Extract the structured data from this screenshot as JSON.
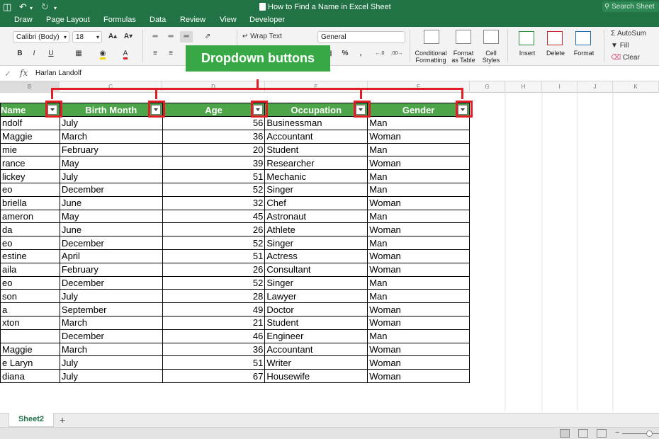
{
  "window": {
    "title": "How to Find a Name in Excel Sheet",
    "search_placeholder": "Search Sheet"
  },
  "ribbon_tabs": [
    "Draw",
    "Page Layout",
    "Formulas",
    "Data",
    "Review",
    "View",
    "Developer"
  ],
  "ribbon": {
    "font_name": "Calibri (Body)",
    "font_size": "18",
    "wrap_text": "Wrap Text",
    "number_format": "General",
    "conditional_formatting": "Conditional Formatting",
    "format_as_table": "Format as Table",
    "cell_styles": "Cell Styles",
    "insert": "Insert",
    "delete": "Delete",
    "format": "Format",
    "autosum": "AutoSum",
    "fill": "Fill",
    "clear": "Clear",
    "bold": "B",
    "italic": "I",
    "underline": "U",
    "percent": "%",
    "comma": ","
  },
  "formula_bar": {
    "fx": "fx",
    "value": "Harlan Landolf"
  },
  "column_letters": [
    "B",
    "C",
    "D",
    "E",
    "F",
    "G",
    "H",
    "I",
    "J",
    "K"
  ],
  "annotation": {
    "label": "Dropdown buttons"
  },
  "table": {
    "headers": [
      "Name",
      "Birth Month",
      "Age",
      "Occupation",
      "Gender"
    ],
    "rows": [
      [
        "ndolf",
        "July",
        "56",
        "Businessman",
        "Man"
      ],
      [
        "Maggie",
        "March",
        "36",
        "Accountant",
        "Woman"
      ],
      [
        "mie",
        "February",
        "20",
        "Student",
        "Man"
      ],
      [
        "rance",
        "May",
        "39",
        "Researcher",
        "Woman"
      ],
      [
        "lickey",
        "July",
        "51",
        "Mechanic",
        "Man"
      ],
      [
        "eo",
        "December",
        "52",
        "Singer",
        "Man"
      ],
      [
        "briella",
        "June",
        "32",
        "Chef",
        "Woman"
      ],
      [
        "ameron",
        "May",
        "45",
        "Astronaut",
        "Man"
      ],
      [
        "da",
        "June",
        "26",
        "Athlete",
        "Woman"
      ],
      [
        "eo",
        "December",
        "52",
        "Singer",
        "Man"
      ],
      [
        "estine",
        "April",
        "51",
        "Actress",
        "Woman"
      ],
      [
        "aila",
        "February",
        "26",
        "Consultant",
        "Woman"
      ],
      [
        "eo",
        "December",
        "52",
        "Singer",
        "Man"
      ],
      [
        "son",
        "July",
        "28",
        "Lawyer",
        "Man"
      ],
      [
        "a",
        "September",
        "49",
        "Doctor",
        "Woman"
      ],
      [
        "xton",
        "March",
        "21",
        "Student",
        "Woman"
      ],
      [
        "",
        "December",
        "46",
        "Engineer",
        "Man"
      ],
      [
        "Maggie",
        "March",
        "36",
        "Accountant",
        "Woman"
      ],
      [
        "e Laryn",
        "July",
        "51",
        "Writer",
        "Woman"
      ],
      [
        "diana",
        "July",
        "67",
        "Housewife",
        "Woman"
      ]
    ]
  },
  "sheet_tabs": {
    "active": "Sheet2",
    "add": "+"
  },
  "colors": {
    "excel_green": "#217346",
    "header_fill": "#4ea448",
    "callout_fill": "#38a847",
    "highlight_red": "#e01e26"
  }
}
